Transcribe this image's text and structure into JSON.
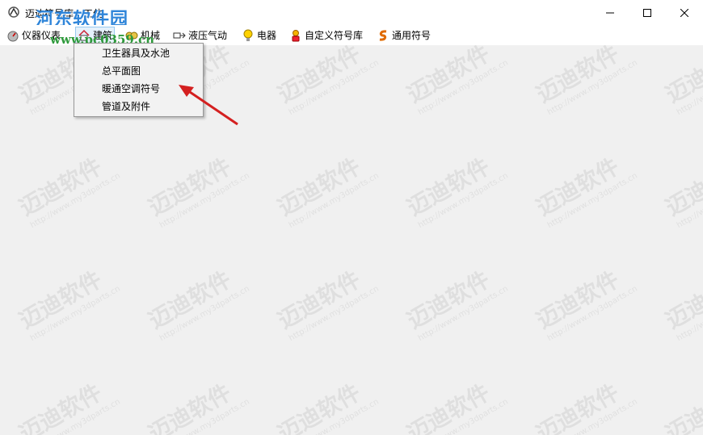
{
  "window": {
    "title": "迈迪符号库－工位",
    "minimize_glyph": "─",
    "maximize_glyph": "☐",
    "close_glyph": "✕"
  },
  "menubar": {
    "items": [
      {
        "label": "仪器仪表",
        "icon": "instrument-icon"
      },
      {
        "label": "建筑",
        "icon": "house-icon"
      },
      {
        "label": "机械",
        "icon": "gear-icon"
      },
      {
        "label": "液压气动",
        "icon": "hydraulic-icon"
      },
      {
        "label": "电器",
        "icon": "bulb-icon"
      },
      {
        "label": "自定义符号库",
        "icon": "custom-library-icon"
      },
      {
        "label": "通用符号",
        "icon": "general-symbol-icon"
      }
    ]
  },
  "dropdown": {
    "items": [
      "卫生器具及水池",
      "总平面图",
      "暖通空调符号",
      "管道及附件"
    ]
  },
  "watermark": {
    "site_name": "河东软件园",
    "site_url": "www.pc0359.cn",
    "tile_text": "迈迪软件",
    "tile_url": "http://www.my3dparts.cn"
  },
  "colors": {
    "arrow": "#d42020",
    "active_border": "#99c9ef",
    "active_bg": "#e5f1fb"
  }
}
